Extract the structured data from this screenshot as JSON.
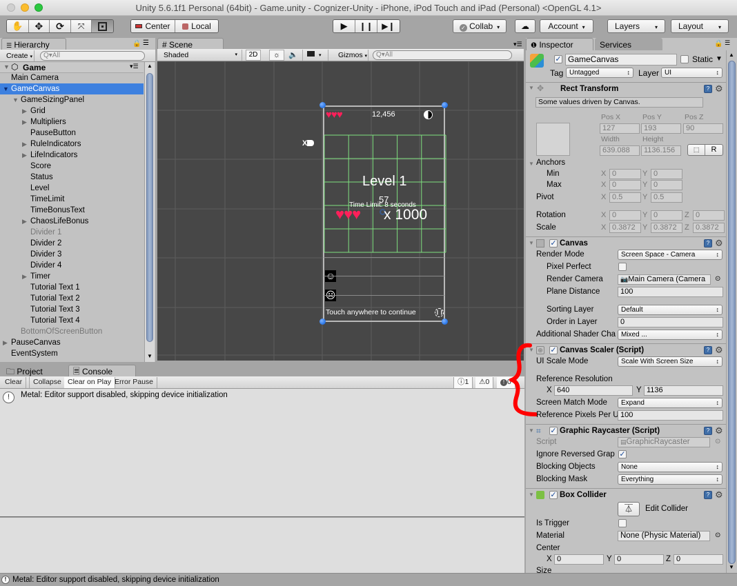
{
  "window": {
    "title": "Unity 5.6.1f1 Personal (64bit) - Game.unity - Cognizer-Unity - iPhone, iPod Touch and iPad (Personal) <OpenGL 4.1>"
  },
  "toolbar": {
    "tools": [
      "hand-tool",
      "move-tool",
      "rotate-tool",
      "scale-tool",
      "rect-tool"
    ],
    "active_tool": "rect-tool",
    "pivot_label": "Center",
    "space_label": "Local",
    "play_controls": [
      "play",
      "pause",
      "step"
    ],
    "collab_label": "Collab",
    "account_label": "Account",
    "layers_label": "Layers",
    "layout_label": "Layout"
  },
  "hierarchy": {
    "tab_label": "Hierarchy",
    "create_label": "Create",
    "search_placeholder": "Q▾All",
    "scene_name": "Game",
    "items": [
      {
        "label": "Main Camera",
        "depth": 1,
        "arrow": "none",
        "state": "normal"
      },
      {
        "label": "GameCanvas",
        "depth": 1,
        "arrow": "open",
        "state": "selected"
      },
      {
        "label": "GameSizingPanel",
        "depth": 2,
        "arrow": "open",
        "state": "normal"
      },
      {
        "label": "Grid",
        "depth": 3,
        "arrow": "closed",
        "state": "normal"
      },
      {
        "label": "Multipliers",
        "depth": 3,
        "arrow": "closed",
        "state": "normal"
      },
      {
        "label": "PauseButton",
        "depth": 3,
        "arrow": "none",
        "state": "normal"
      },
      {
        "label": "RuleIndicators",
        "depth": 3,
        "arrow": "closed",
        "state": "normal"
      },
      {
        "label": "LifeIndicators",
        "depth": 3,
        "arrow": "closed",
        "state": "normal"
      },
      {
        "label": "Score",
        "depth": 3,
        "arrow": "none",
        "state": "normal"
      },
      {
        "label": "Status",
        "depth": 3,
        "arrow": "none",
        "state": "normal"
      },
      {
        "label": "Level",
        "depth": 3,
        "arrow": "none",
        "state": "normal"
      },
      {
        "label": "TimeLimit",
        "depth": 3,
        "arrow": "none",
        "state": "normal"
      },
      {
        "label": "TimeBonusText",
        "depth": 3,
        "arrow": "none",
        "state": "normal"
      },
      {
        "label": "ChaosLifeBonus",
        "depth": 3,
        "arrow": "closed",
        "state": "normal"
      },
      {
        "label": "Divider 1",
        "depth": 3,
        "arrow": "none",
        "state": "inactive"
      },
      {
        "label": "Divider 2",
        "depth": 3,
        "arrow": "none",
        "state": "normal"
      },
      {
        "label": "Divider 3",
        "depth": 3,
        "arrow": "none",
        "state": "normal"
      },
      {
        "label": "Divider 4",
        "depth": 3,
        "arrow": "none",
        "state": "normal"
      },
      {
        "label": "Timer",
        "depth": 3,
        "arrow": "closed",
        "state": "normal"
      },
      {
        "label": "Tutorial Text 1",
        "depth": 3,
        "arrow": "none",
        "state": "normal"
      },
      {
        "label": "Tutorial Text 2",
        "depth": 3,
        "arrow": "none",
        "state": "normal"
      },
      {
        "label": "Tutorial Text 3",
        "depth": 3,
        "arrow": "none",
        "state": "normal"
      },
      {
        "label": "Tutorial Text 4",
        "depth": 3,
        "arrow": "none",
        "state": "normal"
      },
      {
        "label": "BottomOfScreenButton",
        "depth": 2,
        "arrow": "none",
        "state": "inactive"
      },
      {
        "label": "PauseCanvas",
        "depth": 1,
        "arrow": "closed",
        "state": "normal"
      },
      {
        "label": "EventSystem",
        "depth": 1,
        "arrow": "none",
        "state": "normal"
      }
    ]
  },
  "scene": {
    "tab_label": "Scene",
    "shading_mode": "Shaded",
    "mode_2d_label": "2D",
    "gizmos_label": "Gizmos",
    "search_placeholder": "Q▾All",
    "game": {
      "score": "12,456",
      "level": "Level 1",
      "timer": "57",
      "time_limit": "Time Limit: 8 seconds",
      "multiplier": "x 1000",
      "offscreen_label": "X",
      "continue_text": "Touch anywhere to continue",
      "lives": 3,
      "bonus_hearts": 3,
      "heart_color": "#ff1f5a",
      "grid_color": "#7fe07f",
      "handle_color": "#2f7bea"
    }
  },
  "inspector": {
    "tab_label": "Inspector",
    "services_tab_label": "Services",
    "object_name": "GameCanvas",
    "active": true,
    "static_label": "Static",
    "static": false,
    "tag_label": "Tag",
    "tag_value": "Untagged",
    "layer_label": "Layer",
    "layer_value": "UI",
    "rect_transform": {
      "title": "Rect Transform",
      "driven_note": "Some values driven by Canvas.",
      "pos_x_label": "Pos X",
      "pos_y_label": "Pos Y",
      "pos_z_label": "Pos Z",
      "pos_x": "127",
      "pos_y": "193",
      "pos_z": "90",
      "width_label": "Width",
      "height_label": "Height",
      "width": "639.088",
      "height": "1136.156",
      "raw_edit_label": "R",
      "anchors_label": "Anchors",
      "min_label": "Min",
      "max_label": "Max",
      "anchor_min_x": "0",
      "anchor_min_y": "0",
      "anchor_max_x": "0",
      "anchor_max_y": "0",
      "pivot_label": "Pivot",
      "pivot_x": "0.5",
      "pivot_y": "0.5",
      "rotation_label": "Rotation",
      "rotation_x": "0",
      "rotation_y": "0",
      "rotation_z": "0",
      "scale_label": "Scale",
      "scale_x": "0.3872",
      "scale_y": "0.3872",
      "scale_z": "0.3872"
    },
    "canvas": {
      "title": "Canvas",
      "enabled": true,
      "render_mode_label": "Render Mode",
      "render_mode": "Screen Space - Camera",
      "pixel_perfect_label": "Pixel Perfect",
      "pixel_perfect": false,
      "render_camera_label": "Render Camera",
      "render_camera": "Main Camera (Camera",
      "plane_distance_label": "Plane Distance",
      "plane_distance": "100",
      "sorting_layer_label": "Sorting Layer",
      "sorting_layer": "Default",
      "order_in_layer_label": "Order in Layer",
      "order_in_layer": "0",
      "shader_channels_label": "Additional Shader Cha",
      "shader_channels": "Mixed ..."
    },
    "canvas_scaler": {
      "title": "Canvas Scaler (Script)",
      "enabled": true,
      "scale_mode_label": "UI Scale Mode",
      "scale_mode": "Scale With Screen Size",
      "ref_resolution_label": "Reference Resolution",
      "ref_x": "640",
      "ref_y": "1136",
      "match_mode_label": "Screen Match Mode",
      "match_mode": "Expand",
      "ref_ppu_label": "Reference Pixels Per U",
      "ref_ppu": "100"
    },
    "graphic_raycaster": {
      "title": "Graphic Raycaster (Script)",
      "enabled": true,
      "script_label": "Script",
      "script_value": "GraphicRaycaster",
      "ignore_reversed_label": "Ignore Reversed Grap",
      "ignore_reversed": true,
      "blocking_objects_label": "Blocking Objects",
      "blocking_objects": "None",
      "blocking_mask_label": "Blocking Mask",
      "blocking_mask": "Everything"
    },
    "box_collider": {
      "title": "Box Collider",
      "enabled": true,
      "edit_collider_label": "Edit Collider",
      "is_trigger_label": "Is Trigger",
      "is_trigger": false,
      "material_label": "Material",
      "material": "None (Physic Material)",
      "center_label": "Center",
      "center_x": "0",
      "center_y": "0",
      "center_z": "0",
      "size_label": "Size"
    }
  },
  "console": {
    "project_tab_label": "Project",
    "console_tab_label": "Console",
    "clear_label": "Clear",
    "collapse_label": "Collapse",
    "clear_on_play_label": "Clear on Play",
    "error_pause_label": "Error Pause",
    "info_count": "1",
    "warning_count": "0",
    "error_count": "0",
    "messages": [
      "Metal: Editor support disabled, skipping device initialization"
    ]
  },
  "status_bar": {
    "message": "Metal: Editor support disabled, skipping device initialization"
  },
  "annotation": {
    "color": "#ff0000"
  }
}
